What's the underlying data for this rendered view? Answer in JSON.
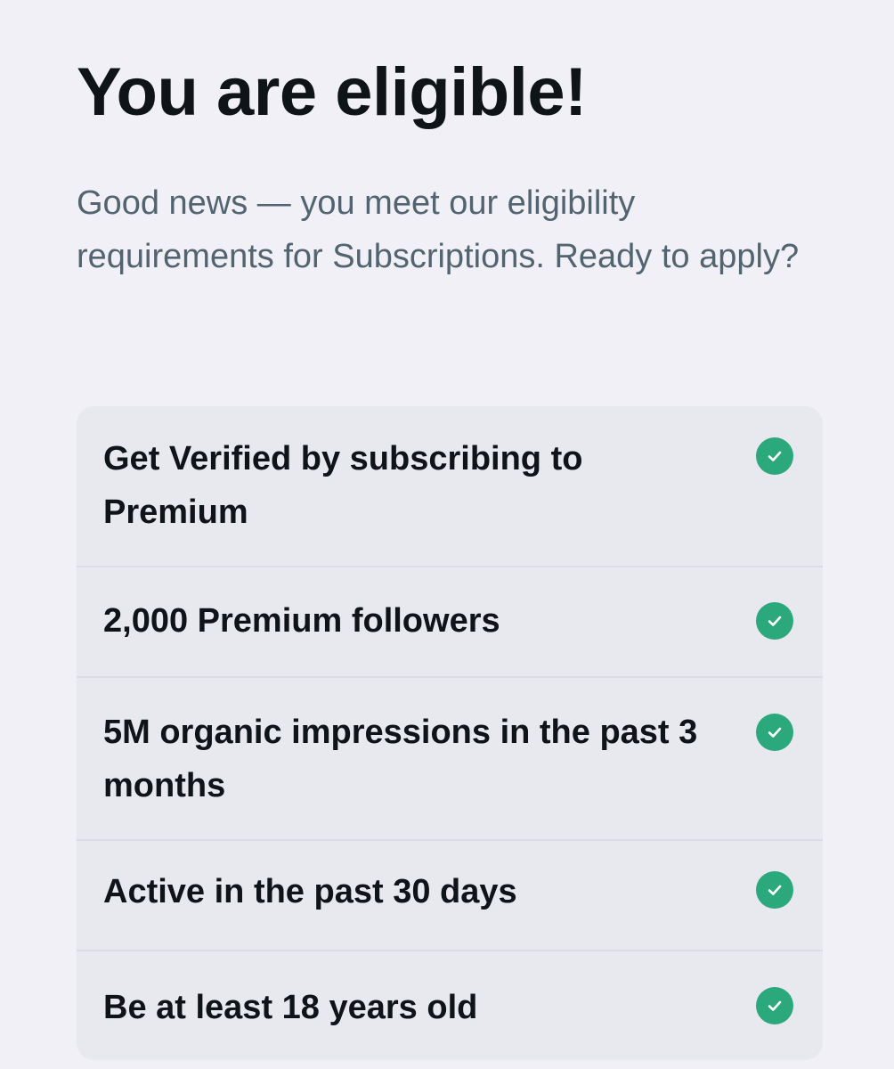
{
  "header": {
    "title": "You are eligible!",
    "subtitle": "Good news — you meet our eligibility requirements for Subscriptions. Ready to apply?"
  },
  "requirements": {
    "items": [
      {
        "label": "Get Verified by subscribing to Premium",
        "met": true,
        "icon": "check-circle-icon"
      },
      {
        "label": "2,000 Premium followers",
        "met": true,
        "icon": "check-circle-icon"
      },
      {
        "label": "5M organic impressions in the past 3 months",
        "met": true,
        "icon": "check-circle-icon"
      },
      {
        "label": "Active in the past 30 days",
        "met": true,
        "icon": "check-circle-icon"
      },
      {
        "label": "Be at least 18 years old",
        "met": true,
        "icon": "check-circle-icon"
      }
    ]
  },
  "colors": {
    "background": "#f0f0f6",
    "card": "#e8e8ef",
    "title": "#0f1419",
    "subtitle": "#536471",
    "check": "#2ba87c"
  }
}
